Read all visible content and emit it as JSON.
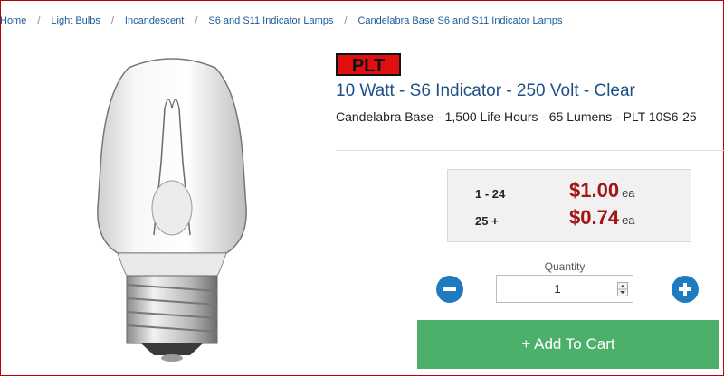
{
  "breadcrumb": [
    {
      "label": "Home"
    },
    {
      "label": "Light Bulbs"
    },
    {
      "label": "Incandescent"
    },
    {
      "label": "S6 and S11 Indicator Lamps"
    },
    {
      "label": "Candelabra Base S6 and S11 Indicator Lamps"
    }
  ],
  "brand": {
    "logo_text": "PLT",
    "logo_color": "#e01010"
  },
  "product": {
    "title": "10 Watt - S6 Indicator - 250 Volt - Clear",
    "subtitle": "Candelabra Base - 1,500 Life Hours - 65 Lumens - PLT 10S6-25"
  },
  "pricing": [
    {
      "qty": "1 - 24",
      "price": "$1.00",
      "unit": "ea"
    },
    {
      "qty": "25 +",
      "price": "$0.74",
      "unit": "ea"
    }
  ],
  "quantity": {
    "label": "Quantity",
    "value": "1"
  },
  "cart": {
    "label": "+ Add To Cart"
  },
  "colors": {
    "accent": "#1f7bbf",
    "cart": "#4caf6a",
    "price": "#a31515",
    "title": "#1e4f86"
  },
  "icons": {
    "minus": "minus-circle-icon",
    "plus": "plus-circle-icon"
  }
}
